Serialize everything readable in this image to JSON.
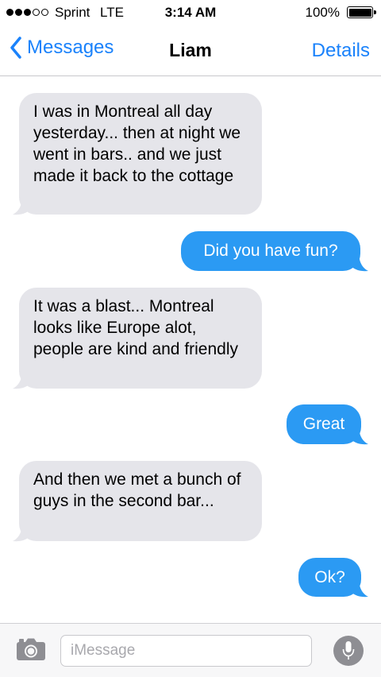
{
  "status_bar": {
    "carrier": "Sprint",
    "network": "LTE",
    "time": "3:14 AM",
    "battery_percent": "100%",
    "signal_bars_filled": 3,
    "signal_bars_total": 5
  },
  "nav": {
    "back_label": "Messages",
    "title": "Liam",
    "details_label": "Details"
  },
  "messages": [
    {
      "direction": "received",
      "text": "I was in Montreal all day yesterday... then at night we went in bars.. and we just made it back to the cottage"
    },
    {
      "direction": "sent",
      "text": "Did you have fun?"
    },
    {
      "direction": "received",
      "text": "It was a blast... Montreal looks like Europe alot, people are kind and friendly"
    },
    {
      "direction": "sent",
      "text": "Great"
    },
    {
      "direction": "received",
      "text": "And then we met a bunch of guys in the second bar..."
    },
    {
      "direction": "sent",
      "text": "Ok?"
    }
  ],
  "input": {
    "placeholder": "iMessage",
    "value": ""
  },
  "colors": {
    "accent": "#1a82fb",
    "sent_bubble": "#2b9af3",
    "received_bubble": "#e5e5ea",
    "mic_button": "#8e8e93"
  }
}
